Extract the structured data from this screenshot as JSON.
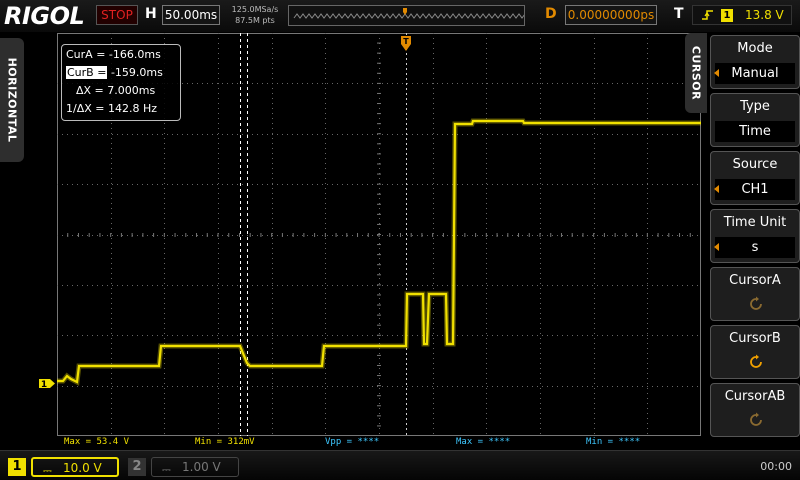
{
  "header": {
    "brand": "RIGOL",
    "run_status": "STOP",
    "horizontal_label": "H",
    "timebase": "50.00ms",
    "sample_rate": "125.0MSa/s",
    "memory_depth": "87.5M pts",
    "delay_label": "D",
    "delay": "0.00000000ps",
    "trigger_label": "T",
    "trigger_channel": "1",
    "trigger_level": "13.8 V"
  },
  "left_tab": {
    "label": "HORIZONTAL"
  },
  "cursor_readout": {
    "cura_label": "CurA =",
    "cura_value": "-166.0ms",
    "curb_label": "CurB =",
    "curb_value": "-159.0ms",
    "delta_label": "ΔX =",
    "delta_value": "7.000ms",
    "inv_label": "1/ΔX =",
    "inv_value": "142.8 Hz"
  },
  "channel_marker": "1",
  "measurements": {
    "max": "Max = 53.4 V",
    "min": "Min = 312mV",
    "vpp": "Vpp = ****",
    "max2": "Max = ****",
    "min2": "Min = ****"
  },
  "menu": {
    "title": "CURSOR",
    "items": [
      {
        "label": "Mode",
        "value": "Manual"
      },
      {
        "label": "Type",
        "value": "Time"
      },
      {
        "label": "Source",
        "value": "CH1"
      },
      {
        "label": "Time Unit",
        "value": "s"
      },
      {
        "label": "CursorA"
      },
      {
        "label": "CursorB"
      },
      {
        "label": "CursorAB"
      }
    ]
  },
  "status_bar": {
    "ch1_number": "1",
    "ch1_scale": "10.0 V",
    "ch2_number": "2",
    "ch2_scale": "1.00 V",
    "time": "00:00"
  },
  "colors": {
    "ch1": "#f0e000",
    "accent_orange": "#e28a00",
    "stop_red": "#e02020",
    "measure_cyan": "#3ec8ff"
  }
}
